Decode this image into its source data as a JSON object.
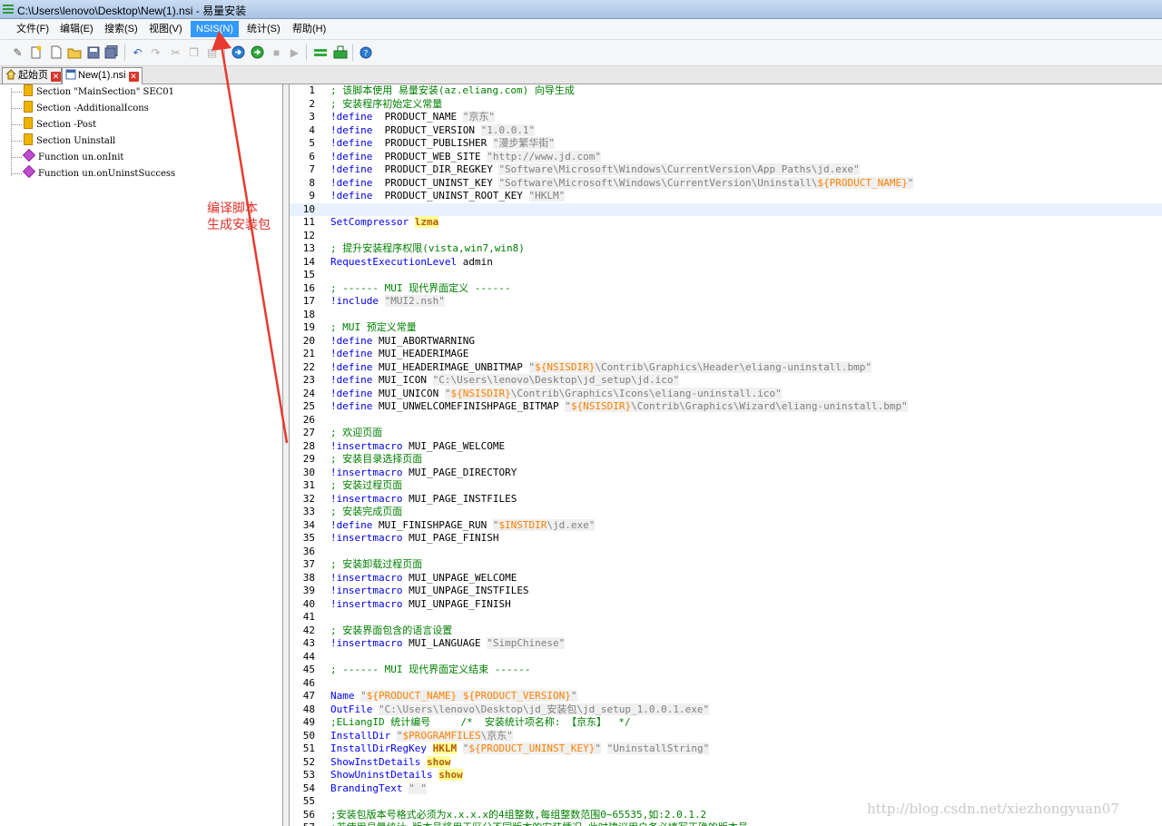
{
  "window": {
    "title": "C:\\Users\\lenovo\\Desktop\\New(1).nsi - 易量安装"
  },
  "menu": [
    {
      "label": "文件(F)"
    },
    {
      "label": "编辑(E)"
    },
    {
      "label": "搜索(S)"
    },
    {
      "label": "视图(V)"
    },
    {
      "label": "NSIS(N)",
      "active": true
    },
    {
      "label": "统计(S)"
    },
    {
      "label": "帮助(H)"
    }
  ],
  "tabs": [
    {
      "label": "起始页"
    },
    {
      "label": "New(1).nsi",
      "active": true
    }
  ],
  "tree": [
    {
      "kind": "section",
      "label": "Section \"MainSection\" SEC01"
    },
    {
      "kind": "section",
      "label": "Section -AdditionalIcons"
    },
    {
      "kind": "section",
      "label": "Section -Post"
    },
    {
      "kind": "section",
      "label": "Section Uninstall"
    },
    {
      "kind": "function",
      "label": "Function un.onInit"
    },
    {
      "kind": "function",
      "label": "Function un.onUninstSuccess"
    }
  ],
  "annotation": {
    "line1": "编译脚本",
    "line2": "生成安装包"
  },
  "watermark": "http://blog.csdn.net/xiezhongyuan07",
  "editor": {
    "current_line": 10,
    "lines": [
      [
        [
          "cm",
          "; 该脚本使用 易量安装(az.eliang.com) 向导生成"
        ]
      ],
      [
        [
          "cm",
          "; 安装程序初始定义常量"
        ]
      ],
      [
        [
          "dr",
          "!define"
        ],
        [
          "",
          "  PRODUCT_NAME "
        ],
        [
          "s",
          "\"京东\""
        ]
      ],
      [
        [
          "dr",
          "!define"
        ],
        [
          "",
          "  PRODUCT_VERSION "
        ],
        [
          "s",
          "\"1.0.0.1\""
        ]
      ],
      [
        [
          "dr",
          "!define"
        ],
        [
          "",
          "  PRODUCT_PUBLISHER "
        ],
        [
          "s",
          "\"漫步繁华街\""
        ]
      ],
      [
        [
          "dr",
          "!define"
        ],
        [
          "",
          "  PRODUCT_WEB_SITE "
        ],
        [
          "s",
          "\"http://www.jd.com\""
        ]
      ],
      [
        [
          "dr",
          "!define"
        ],
        [
          "",
          "  PRODUCT_DIR_REGKEY "
        ],
        [
          "s",
          "\"Software\\Microsoft\\Windows\\CurrentVersion\\App Paths\\jd.exe\""
        ]
      ],
      [
        [
          "dr",
          "!define"
        ],
        [
          "",
          "  PRODUCT_UNINST_KEY "
        ],
        [
          "s",
          "\"Software\\Microsoft\\Windows\\CurrentVersion\\Uninstall\\"
        ],
        [
          "sv",
          "${PRODUCT_NAME}"
        ],
        [
          "s",
          "\""
        ]
      ],
      [
        [
          "dr",
          "!define"
        ],
        [
          "",
          "  PRODUCT_UNINST_ROOT_KEY "
        ],
        [
          "s",
          "\"HKLM\""
        ]
      ],
      [],
      [
        [
          "kw",
          "SetCompressor"
        ],
        [
          "",
          " "
        ],
        [
          "hl",
          "lzma"
        ]
      ],
      [],
      [
        [
          "cm",
          "; 提升安装程序权限(vista,win7,win8)"
        ]
      ],
      [
        [
          "kw",
          "RequestExecutionLevel"
        ],
        [
          "",
          " admin"
        ]
      ],
      [],
      [
        [
          "cm",
          "; ------ MUI 现代界面定义 ------"
        ]
      ],
      [
        [
          "dr",
          "!include"
        ],
        [
          "",
          " "
        ],
        [
          "s",
          "\"MUI2.nsh\""
        ]
      ],
      [],
      [
        [
          "cm",
          "; MUI 预定义常量"
        ]
      ],
      [
        [
          "dr",
          "!define"
        ],
        [
          "",
          " MUI_ABORTWARNING"
        ]
      ],
      [
        [
          "dr",
          "!define"
        ],
        [
          "",
          " MUI_HEADERIMAGE"
        ]
      ],
      [
        [
          "dr",
          "!define"
        ],
        [
          "",
          " MUI_HEADERIMAGE_UNBITMAP "
        ],
        [
          "s",
          "\""
        ],
        [
          "sv",
          "${NSISDIR}"
        ],
        [
          "s",
          "\\Contrib\\Graphics\\Header\\eliang-uninstall.bmp\""
        ]
      ],
      [
        [
          "dr",
          "!define"
        ],
        [
          "",
          " MUI_ICON "
        ],
        [
          "s",
          "\"C:\\Users\\lenovo\\Desktop\\jd_setup\\jd.ico\""
        ]
      ],
      [
        [
          "dr",
          "!define"
        ],
        [
          "",
          " MUI_UNICON "
        ],
        [
          "s",
          "\""
        ],
        [
          "sv",
          "${NSISDIR}"
        ],
        [
          "s",
          "\\Contrib\\Graphics\\Icons\\eliang-uninstall.ico\""
        ]
      ],
      [
        [
          "dr",
          "!define"
        ],
        [
          "",
          " MUI_UNWELCOMEFINISHPAGE_BITMAP "
        ],
        [
          "s",
          "\""
        ],
        [
          "sv",
          "${NSISDIR}"
        ],
        [
          "s",
          "\\Contrib\\Graphics\\Wizard\\eliang-uninstall.bmp\""
        ]
      ],
      [],
      [
        [
          "cm",
          "; 欢迎页面"
        ]
      ],
      [
        [
          "dr",
          "!insertmacro"
        ],
        [
          "",
          " MUI_PAGE_WELCOME"
        ]
      ],
      [
        [
          "cm",
          "; 安装目录选择页面"
        ]
      ],
      [
        [
          "dr",
          "!insertmacro"
        ],
        [
          "",
          " MUI_PAGE_DIRECTORY"
        ]
      ],
      [
        [
          "cm",
          "; 安装过程页面"
        ]
      ],
      [
        [
          "dr",
          "!insertmacro"
        ],
        [
          "",
          " MUI_PAGE_INSTFILES"
        ]
      ],
      [
        [
          "cm",
          "; 安装完成页面"
        ]
      ],
      [
        [
          "dr",
          "!define"
        ],
        [
          "",
          " MUI_FINISHPAGE_RUN "
        ],
        [
          "s",
          "\""
        ],
        [
          "sv",
          "$INSTDIR"
        ],
        [
          "s",
          "\\jd.exe\""
        ]
      ],
      [
        [
          "dr",
          "!insertmacro"
        ],
        [
          "",
          " MUI_PAGE_FINISH"
        ]
      ],
      [],
      [
        [
          "cm",
          "; 安装卸载过程页面"
        ]
      ],
      [
        [
          "dr",
          "!insertmacro"
        ],
        [
          "",
          " MUI_UNPAGE_WELCOME"
        ]
      ],
      [
        [
          "dr",
          "!insertmacro"
        ],
        [
          "",
          " MUI_UNPAGE_INSTFILES"
        ]
      ],
      [
        [
          "dr",
          "!insertmacro"
        ],
        [
          "",
          " MUI_UNPAGE_FINISH"
        ]
      ],
      [],
      [
        [
          "cm",
          "; 安装界面包含的语言设置"
        ]
      ],
      [
        [
          "dr",
          "!insertmacro"
        ],
        [
          "",
          " MUI_LANGUAGE "
        ],
        [
          "s",
          "\"SimpChinese\""
        ]
      ],
      [],
      [
        [
          "cm",
          "; ------ MUI 现代界面定义结束 ------"
        ]
      ],
      [],
      [
        [
          "kw",
          "Name"
        ],
        [
          "",
          " "
        ],
        [
          "s",
          "\""
        ],
        [
          "sv",
          "${PRODUCT_NAME} ${PRODUCT_VERSION}"
        ],
        [
          "s",
          "\""
        ]
      ],
      [
        [
          "kw",
          "OutFile"
        ],
        [
          "",
          " "
        ],
        [
          "s",
          "\"C:\\Users\\lenovo\\Desktop\\jd_安装包\\jd_setup_1.0.0.1.exe\""
        ]
      ],
      [
        [
          "cm",
          ";ELiangID 统计编号     /*  安装统计项名称: 【京东】  */"
        ]
      ],
      [
        [
          "kw",
          "InstallDir"
        ],
        [
          "",
          " "
        ],
        [
          "s",
          "\""
        ],
        [
          "sv",
          "$PROGRAMFILES"
        ],
        [
          "s",
          "\\京东\""
        ]
      ],
      [
        [
          "kw",
          "InstallDirRegKey"
        ],
        [
          "",
          " "
        ],
        [
          "hl",
          "HKLM"
        ],
        [
          "",
          " "
        ],
        [
          "s",
          "\""
        ],
        [
          "sv",
          "${PRODUCT_UNINST_KEY}"
        ],
        [
          "s",
          "\""
        ],
        [
          "",
          " "
        ],
        [
          "s",
          "\"UninstallString\""
        ]
      ],
      [
        [
          "kw",
          "ShowInstDetails"
        ],
        [
          "",
          " "
        ],
        [
          "hl",
          "show"
        ]
      ],
      [
        [
          "kw",
          "ShowUninstDetails"
        ],
        [
          "",
          " "
        ],
        [
          "hl",
          "show"
        ]
      ],
      [
        [
          "kw",
          "BrandingText"
        ],
        [
          "",
          " "
        ],
        [
          "s",
          "\" \""
        ]
      ],
      [],
      [
        [
          "cm",
          ";安装包版本号格式必须为x.x.x.x的4组整数,每组整数范围0~65535,如:2.0.1.2"
        ]
      ],
      [
        [
          "cm",
          ";若使用易量统计,版本号将用于区分不同版本的安装情况,此时建议用户务必填写正确的版本号"
        ]
      ]
    ]
  }
}
